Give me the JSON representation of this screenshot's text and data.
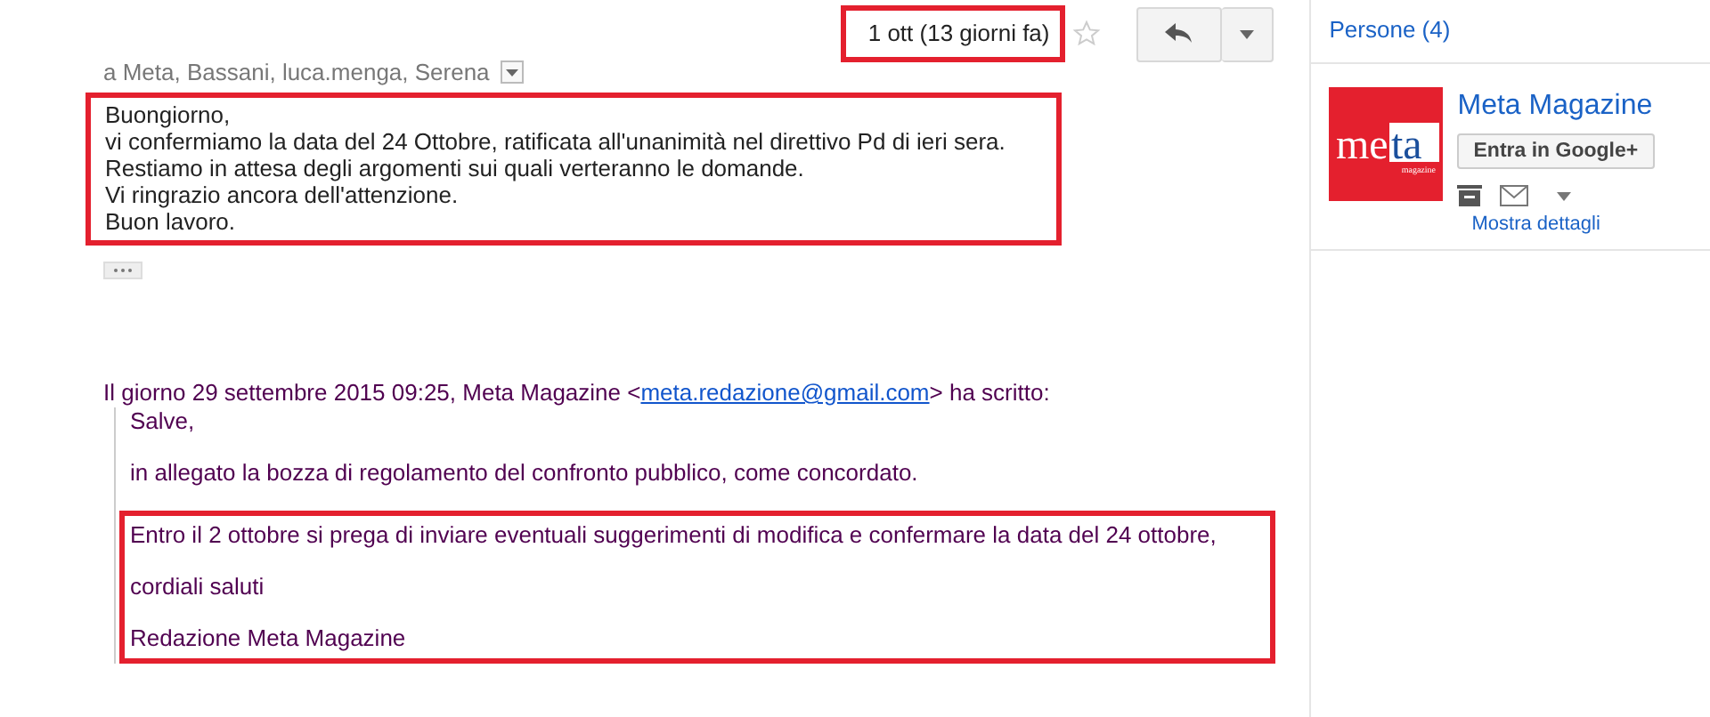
{
  "message": {
    "date": "1 ott (13 giorni fa)",
    "starred": false,
    "recipients": "a Meta, Bassani, luca.menga, Serena",
    "body": [
      "Buongiorno,",
      "vi confermiamo la data del 24 Ottobre, ratificata all'unanimità nel direttivo Pd di ieri sera.",
      "Restiamo in attesa degli argomenti sui quali verteranno le domande.",
      "Vi ringrazio ancora dell'attenzione.",
      "Buon lavoro."
    ],
    "quote_header": {
      "before": "Il giorno 29 settembre 2015 09:25, Meta Magazine <",
      "email": "meta.redazione@gmail.com",
      "after": "> ha scritto:"
    },
    "quoted": [
      {
        "text": "Salve,",
        "highlighted": false
      },
      {
        "text": "in allegato la bozza di regolamento del confronto pubblico, come concordato.",
        "highlighted": false
      },
      {
        "text": "Entro il 2 ottobre si prega di inviare eventuali suggerimenti di modifica e confermare la data del 24 ottobre,",
        "highlighted": true
      },
      {
        "text": "cordiali saluti",
        "highlighted": true
      },
      {
        "text": "Redazione Meta Magazine",
        "highlighted": true
      }
    ]
  },
  "sidebar": {
    "title": "Persone (4)",
    "contact": {
      "name": "Meta Magazine",
      "logo": {
        "word_a": "me",
        "word_b": "ta",
        "small": "magazine"
      },
      "button": "Entra in Google+",
      "details_link": "Mostra dettagli"
    }
  }
}
